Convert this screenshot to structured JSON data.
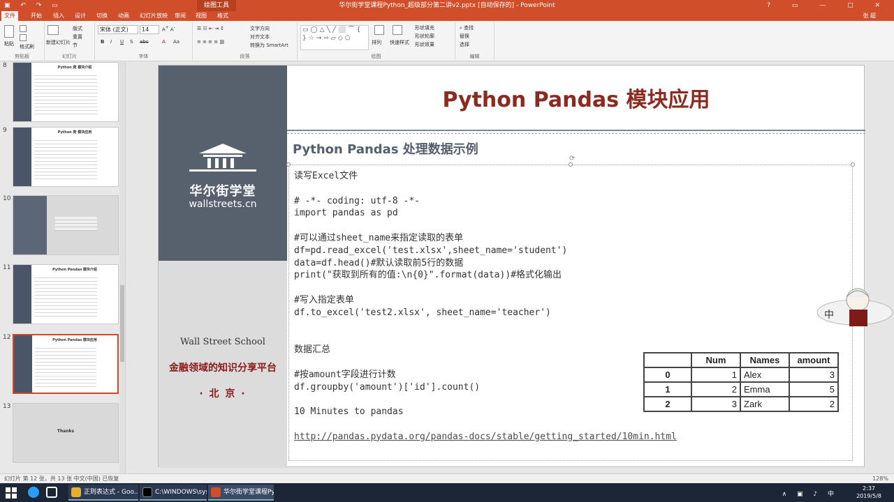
{
  "titlebar": {
    "drawing_tools": "绘图工具",
    "title": "华尔街学堂课程Python_超级部分第二讲v2.pptx [自动保存的] - PowerPoint",
    "qat_icons": [
      "save-icon",
      "undo-icon",
      "redo-icon",
      "present-icon"
    ]
  },
  "tabs": [
    "文件",
    "开始",
    "插入",
    "设计",
    "切换",
    "动画",
    "幻灯片放映",
    "审阅",
    "视图",
    "格式"
  ],
  "account": "张 超",
  "ribbon": {
    "groups": [
      {
        "label": "剪贴板",
        "buttons": [
          "粘贴",
          "剪切",
          "复制",
          "格式刷"
        ]
      },
      {
        "label": "幻灯片",
        "buttons": [
          "新建幻灯片",
          "版式",
          "重置",
          "节"
        ]
      },
      {
        "label": "字体",
        "font_name": "宋体 (正文)",
        "font_size": "14",
        "buttons": [
          "B",
          "I",
          "U",
          "S",
          "abc",
          "A",
          "Aa"
        ]
      },
      {
        "label": "段落",
        "buttons": [
          "文字方向",
          "对齐文本",
          "转换为 SmartArt"
        ]
      },
      {
        "label": "绘图",
        "buttons": [
          "排列",
          "快速样式",
          "形状填充",
          "形状轮廓",
          "形状效果"
        ]
      },
      {
        "label": "编辑",
        "buttons": [
          "查找",
          "替换",
          "选择"
        ]
      }
    ]
  },
  "thumbnails": [
    {
      "num": "8",
      "title": "Python 爬 模块介绍"
    },
    {
      "num": "9",
      "title": "Python 爬 模块应用"
    },
    {
      "num": "10",
      "title": ""
    },
    {
      "num": "11",
      "title": "Python Pandas 模块介绍"
    },
    {
      "num": "12",
      "title": "Python Pandas 模块应用"
    },
    {
      "num": "13",
      "title": "Thanks"
    }
  ],
  "slide": {
    "school_cn": "华尔街学堂",
    "school_url": "wallstreets.cn",
    "school_en": "Wall Street School",
    "slogan": "金融领域的知识分享平台",
    "city": "· 北 京 ·",
    "title": "Python  Pandas 模块应用",
    "subtitle": "Python Pandas 处理数据示例",
    "code_lines": [
      "读写Excel文件",
      "",
      "# -*- coding: utf-8 -*-",
      "import pandas as pd",
      "",
      "#可以通过sheet_name来指定读取的表单",
      "df=pd.read_excel('test.xlsx',sheet_name='student')",
      "data=df.head()#默认读取前5行的数据",
      "print(\"获取到所有的值:\\n{0}\".format(data))#格式化输出",
      "",
      "#写入指定表单",
      "df.to_excel('test2.xlsx', sheet_name='teacher')",
      "",
      "",
      "数据汇总",
      "",
      "#按amount字段进行计数",
      "df.groupby('amount')['id'].count()",
      "",
      "10 Minutes to pandas",
      "",
      "http://pandas.pydata.org/pandas-docs/stable/getting_started/10min.html"
    ],
    "table": {
      "columns": [
        "Num",
        "Names",
        "amount"
      ],
      "rows": [
        {
          "index": "0",
          "num": "1",
          "name": "Alex",
          "amount": "3"
        },
        {
          "index": "1",
          "num": "2",
          "name": "Emma",
          "amount": "5"
        },
        {
          "index": "2",
          "num": "3",
          "name": "Zark",
          "amount": "2"
        }
      ]
    }
  },
  "status": {
    "left": "幻灯片 第 12 张，共 13 张    中文(中国)    已恢复",
    "zoom": "128%"
  },
  "taskbar": {
    "items": [
      "正则表达式 - Goo...",
      "C:\\WINDOWS\\sys...",
      "华尔街学堂课程Pyt..."
    ],
    "time": "2:37",
    "date": "2019/5/8"
  }
}
